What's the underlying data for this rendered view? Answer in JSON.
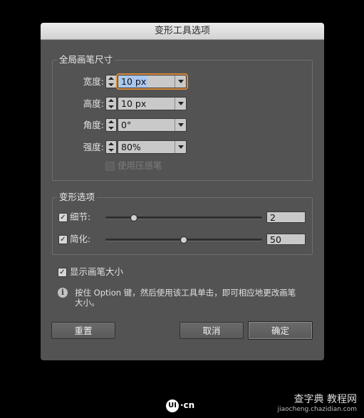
{
  "dialog": {
    "title": "变形工具选项",
    "brush_group": {
      "legend": "全局画笔尺寸",
      "width": {
        "label": "宽度:",
        "value": "10 px"
      },
      "height": {
        "label": "高度:",
        "value": "10 px"
      },
      "angle": {
        "label": "角度:",
        "value": "0°"
      },
      "intensity": {
        "label": "强度:",
        "value": "80%"
      },
      "pressure_pen": {
        "label": "使用压感笔",
        "checked": false,
        "enabled": false
      }
    },
    "warp_group": {
      "legend": "变形选项",
      "detail": {
        "label": "细节:",
        "checked": true,
        "value": "2",
        "slider_fraction": 0.18
      },
      "simplify": {
        "label": "简化:",
        "checked": true,
        "value": "50",
        "slider_fraction": 0.5
      }
    },
    "show_brush_size": {
      "label": "显示画笔大小",
      "checked": true
    },
    "info": {
      "icon": "info-icon",
      "line1": "按住 Option 键，然后使用该工具单击，即可相应地更改画笔",
      "line2": "大小。"
    },
    "buttons": {
      "reset": "重置",
      "cancel": "取消",
      "ok": "确定"
    }
  },
  "branding": {
    "logo_text": "·cn",
    "logo_mark": "UI"
  },
  "watermark": {
    "line1": "查字典 教程网",
    "line2": "jiaocheng.chazidian.com"
  }
}
